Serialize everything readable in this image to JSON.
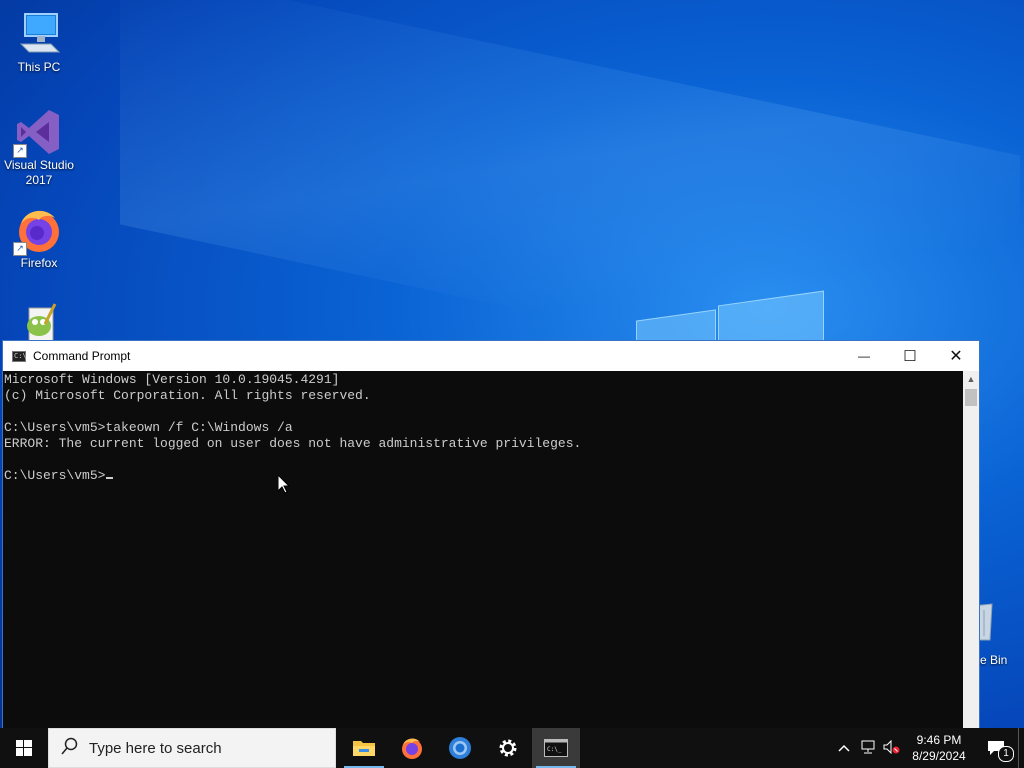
{
  "desktop": {
    "icons": [
      {
        "label": "This PC"
      },
      {
        "label": "Visual Studio\n2017"
      },
      {
        "label": "Firefox"
      },
      {
        "label": ""
      }
    ],
    "recycle_bin_label": "e Bin"
  },
  "window": {
    "title": "Command Prompt",
    "app_icon_text": "C:\\",
    "minimize": "—",
    "maximize": "☐",
    "close": "✕",
    "lines": [
      "Microsoft Windows [Version 10.0.19045.4291]",
      "(c) Microsoft Corporation. All rights reserved.",
      "",
      "C:\\Users\\vm5>takeown /f C:\\Windows /a",
      "ERROR: The current logged on user does not have administrative privileges.",
      ""
    ],
    "prompt": "C:\\Users\\vm5>"
  },
  "taskbar": {
    "search_placeholder": "Type here to search",
    "apps": [
      {
        "icon": "file-explorer-icon"
      },
      {
        "icon": "firefox-icon"
      },
      {
        "icon": "chrome-icon"
      },
      {
        "icon": "settings-icon"
      },
      {
        "icon": "command-prompt-icon"
      }
    ],
    "time": "9:46 PM",
    "date": "8/29/2024",
    "notification_count": "1"
  }
}
